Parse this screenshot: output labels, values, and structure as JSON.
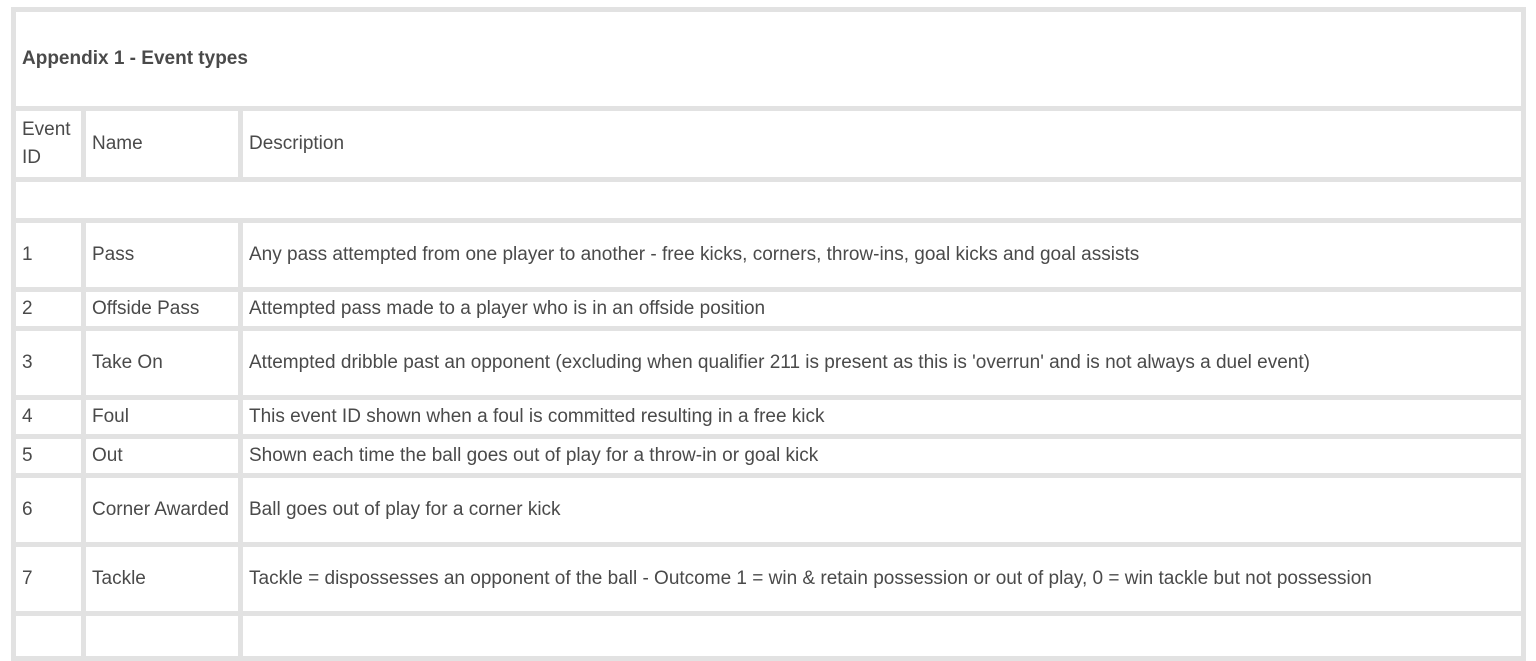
{
  "appendix": {
    "title": "Appendix 1 - Event types"
  },
  "table": {
    "headers": {
      "event_id": "Event ID",
      "name": "Name",
      "description": "Description"
    },
    "rows": [
      {
        "id": "1",
        "name": "Pass",
        "description": "Any pass attempted from one player to another - free kicks, corners, throw-ins, goal kicks and goal assists"
      },
      {
        "id": "2",
        "name": "Offside Pass",
        "description": "Attempted pass made to a player who is in an offside position"
      },
      {
        "id": "3",
        "name": "Take On",
        "description": "Attempted dribble past an opponent (excluding when qualifier 211 is present as this is 'overrun' and is not always a duel event)"
      },
      {
        "id": "4",
        "name": "Foul",
        "description": "This event ID shown when a foul is committed resulting in a free kick"
      },
      {
        "id": "5",
        "name": "Out",
        "description": "Shown each time the ball goes out of play for a throw-in or goal kick"
      },
      {
        "id": "6",
        "name": "Corner Awarded",
        "description": "Ball goes out of play for a corner kick"
      },
      {
        "id": "7",
        "name": "Tackle",
        "description": "Tackle = dispossesses an opponent of the ball - Outcome 1 = win & retain possession or out of play, 0 = win tackle but not possession"
      }
    ]
  }
}
